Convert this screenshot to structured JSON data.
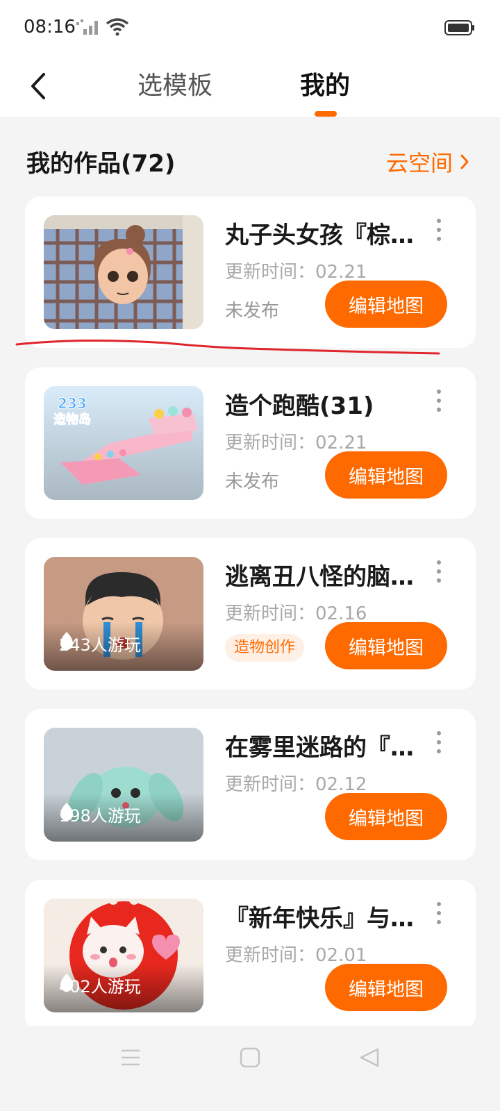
{
  "status_bar": {
    "time": "08:16"
  },
  "nav": {
    "tabs": [
      {
        "label": "选模板"
      },
      {
        "label": "我的"
      }
    ],
    "active_tab": "我的"
  },
  "section": {
    "title": "我的作品(72)",
    "cloud_link": "云空间"
  },
  "colors": {
    "accent": "#ff6a00",
    "annotation": "#e0242c"
  },
  "works": [
    {
      "title": "丸子头女孩『棕…",
      "update_label": "更新时间：",
      "update_date": "02.21",
      "status": "未发布",
      "edit_label": "编辑地图"
    },
    {
      "title": "造个跑酷(31)",
      "update_label": "更新时间：",
      "update_date": "02.21",
      "status": "未发布",
      "edit_label": "编辑地图",
      "thumb_logo_top": "233",
      "thumb_logo_bottom": "造物岛"
    },
    {
      "title": "逃离丑八怪的脑…",
      "update_label": "更新时间：",
      "update_date": "02.16",
      "badge": "造物创作",
      "plays": "243人游玩",
      "edit_label": "编辑地图"
    },
    {
      "title": "在雾里迷路的『…",
      "update_label": "更新时间：",
      "update_date": "02.12",
      "plays": "198人游玩",
      "edit_label": "编辑地图"
    },
    {
      "title": "『新年快乐』与…",
      "update_label": "更新时间：",
      "update_date": "02.01",
      "plays": "402人游玩",
      "edit_label": "编辑地图"
    }
  ],
  "icons": {
    "back": "chevron-left-icon",
    "cloud": "chevron-right-icon",
    "more": "more-vertical-icon",
    "plays": "flame-icon"
  }
}
